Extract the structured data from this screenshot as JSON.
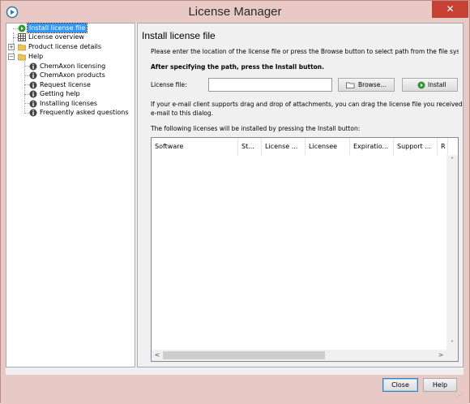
{
  "window": {
    "title": "License Manager",
    "close_glyph": "✕"
  },
  "tree": {
    "items": [
      {
        "label": "Install license file",
        "icon": "play-green-icon"
      },
      {
        "label": "License overview",
        "icon": "table-grid-icon"
      },
      {
        "label": "Product license details",
        "icon": "folder-icon"
      },
      {
        "label": "Help",
        "icon": "folder-icon"
      },
      {
        "label": "ChemAxon licensing",
        "icon": "info-icon"
      },
      {
        "label": "ChemAxon products",
        "icon": "info-icon"
      },
      {
        "label": "Request license",
        "icon": "info-icon"
      },
      {
        "label": "Getting help",
        "icon": "info-icon"
      },
      {
        "label": "Installing licenses",
        "icon": "info-icon"
      },
      {
        "label": "Frequently asked questions",
        "icon": "info-icon"
      }
    ]
  },
  "main": {
    "heading": "Install license file",
    "instruction": "Please enter the location of the license file or press the Browse button to select path from the file system.",
    "instruction_bold": "After specifying the path, press the Install button.",
    "license_label": "License file:",
    "license_value": "",
    "browse_label": "Browse...",
    "install_label": "Install",
    "dragdrop_text_1": "If your e-mail client supports drag and drop of attachments, you can drag the license file you received by",
    "dragdrop_text_2": "e-mail to this dialog.",
    "following_text": "The following licenses will be installed by pressing the Install button:",
    "columns": [
      "Software",
      "St...",
      "License ...",
      "Licensee",
      "Expiratio...",
      "Support ...",
      "R"
    ]
  },
  "footer": {
    "close_label": "Close",
    "help_label": "Help"
  },
  "colors": {
    "titlebar": "#e8c9c5",
    "close": "#c74134",
    "selection": "#3399ff"
  }
}
